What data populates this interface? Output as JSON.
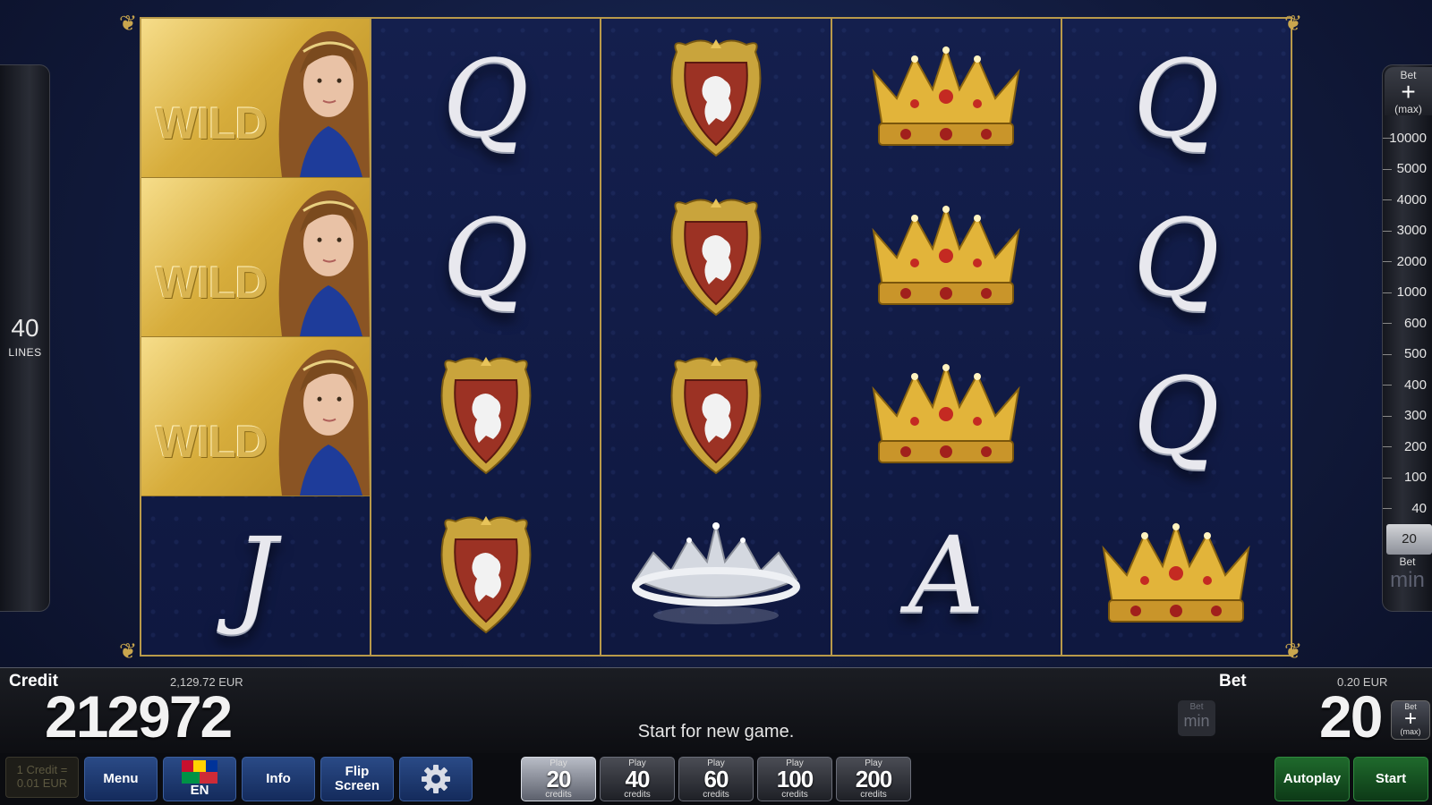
{
  "lines": {
    "value": "40",
    "label": "LINES"
  },
  "bet_ladder": {
    "top_label": "Bet",
    "top_symbol": "+",
    "top_sub": "(max)",
    "steps": [
      "10000",
      "5000",
      "4000",
      "3000",
      "2000",
      "1000",
      "600",
      "500",
      "400",
      "300",
      "200",
      "100",
      "40",
      "20"
    ],
    "active_step": "20",
    "bottom_label": "Bet",
    "bottom_sub": "min"
  },
  "reels": [
    [
      "wild",
      "wild",
      "wild",
      "J"
    ],
    [
      "Q",
      "Q",
      "shield",
      "shield"
    ],
    [
      "shield",
      "shield",
      "shield",
      "silver-crown"
    ],
    [
      "crown",
      "crown",
      "crown",
      "A"
    ],
    [
      "Q",
      "Q",
      "Q",
      "crown"
    ]
  ],
  "wild_text": "WILD",
  "info": {
    "credit_label": "Credit",
    "credit_eur": "2,129.72 EUR",
    "credit_value": "212972",
    "status": "Start for new game.",
    "bet_label": "Bet",
    "bet_eur": "0.20 EUR",
    "bet_value": "20",
    "bet_min_top": "Bet",
    "bet_min_bottom": "min",
    "bet_plus_top": "Bet",
    "bet_plus_symbol": "+",
    "bet_plus_bottom": "(max)"
  },
  "bottom": {
    "denom_line1": "1 Credit =",
    "denom_line2": "0.01 EUR",
    "menu": "Menu",
    "lang": "EN",
    "info": "Info",
    "flip_line1": "Flip",
    "flip_line2": "Screen",
    "play_label": "Play",
    "credits_label": "credits",
    "play_options": [
      "20",
      "40",
      "60",
      "100",
      "200"
    ],
    "autoplay": "Autoplay",
    "start": "Start"
  },
  "colors": {
    "gold": "#b99a4a",
    "reel_bg": "#111a42",
    "button_blue": "#1f3b72",
    "button_green": "#1b5e27"
  },
  "icons": {
    "settings": "gear-icon",
    "language": "flag-icon"
  }
}
